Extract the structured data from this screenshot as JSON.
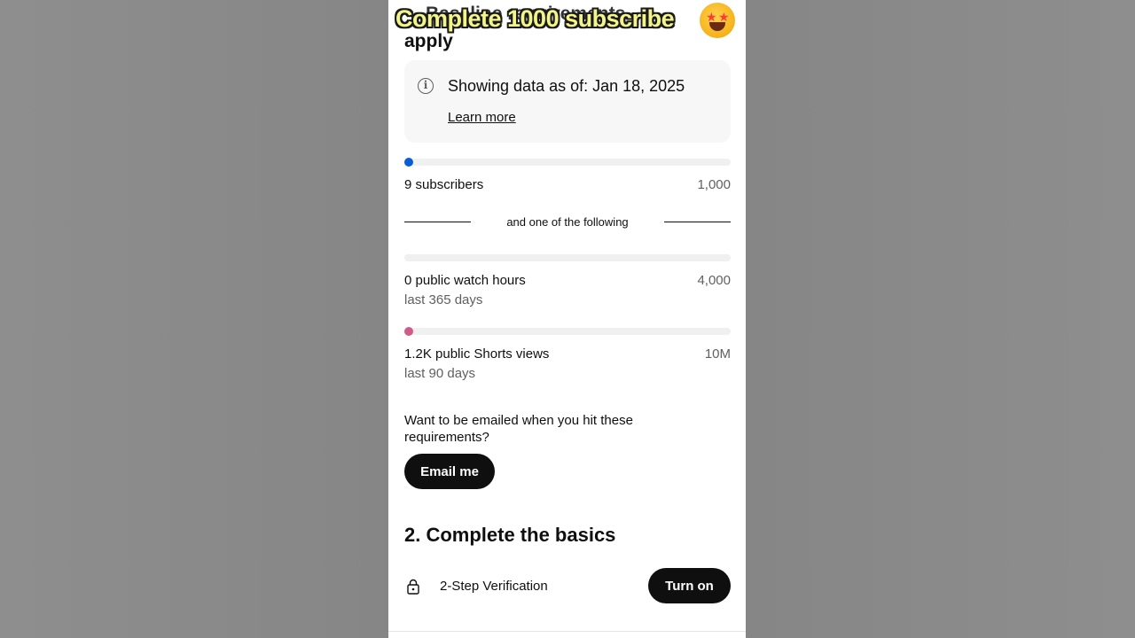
{
  "overlay": {
    "caption": "Complete 1000 subscribe",
    "emoji_icon": "star-struck-emoji-icon"
  },
  "page": {
    "partial_heading_top": "Baseline requirements",
    "partial_heading": "apply"
  },
  "info_card": {
    "icon": "info-icon",
    "text": "Showing data as of: Jan 18, 2025",
    "learn_more": "Learn more"
  },
  "requirements": {
    "subscribers": {
      "label": "9 subscribers",
      "target": "1,000",
      "progress": 0.009,
      "color": "#065fd4"
    },
    "divider": "and one of the following",
    "watch_hours": {
      "label": "0 public watch hours",
      "target": "4,000",
      "period": "last 365 days",
      "progress": 0
    },
    "shorts_views": {
      "label": "1.2K public Shorts views",
      "target": "10M",
      "period": "last 90 days",
      "progress": 0.00012,
      "color": "#d05a8a"
    }
  },
  "email": {
    "question": "Want to be emailed when you hit these requirements?",
    "button": "Email me"
  },
  "basics": {
    "title": "2. Complete the basics",
    "verification_label": "2-Step Verification",
    "verification_icon": "lock-icon",
    "turn_on": "Turn on"
  }
}
